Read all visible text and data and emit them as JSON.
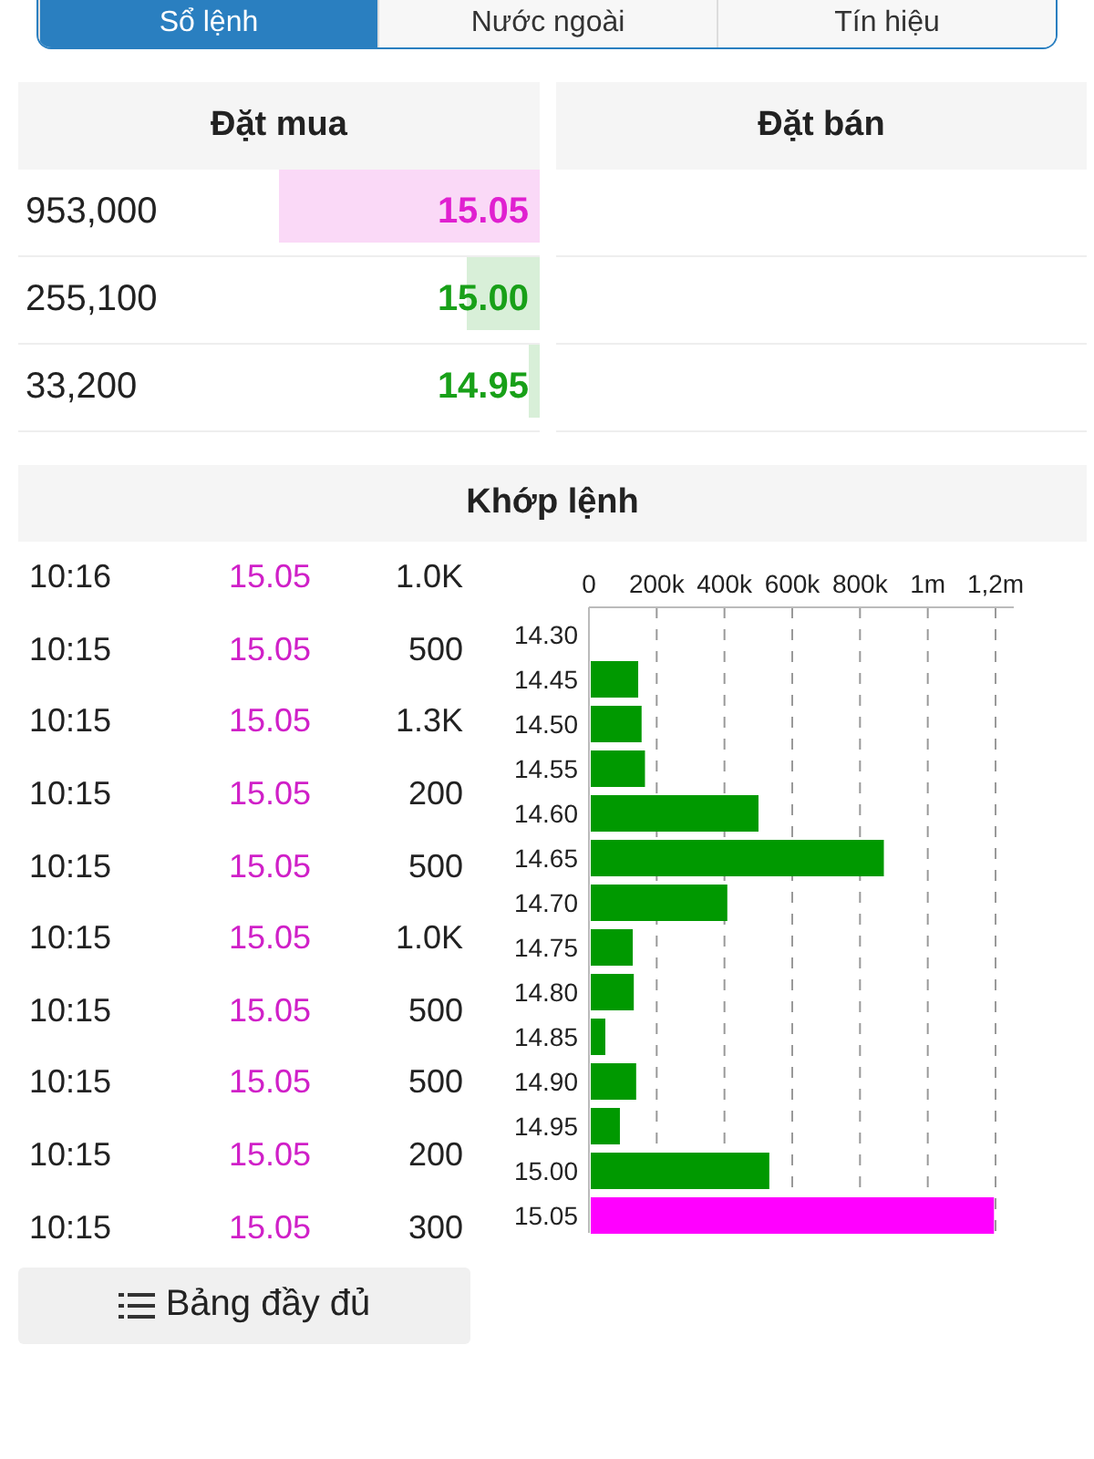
{
  "tabs": [
    {
      "label": "Sổ lệnh",
      "selected": true
    },
    {
      "label": "Nước ngoài",
      "selected": false
    },
    {
      "label": "Tín hiệu",
      "selected": false
    }
  ],
  "order_book": {
    "buy_header": "Đặt mua",
    "sell_header": "Đặt bán",
    "bids": [
      {
        "volume": "953,000",
        "price": "15.05",
        "color": "#e020d0",
        "level": 0.5
      },
      {
        "volume": "255,100",
        "price": "15.00",
        "color": "#18a018",
        "level": 0.14
      },
      {
        "volume": "33,200",
        "price": "14.95",
        "color": "#18a018",
        "level": 0.02
      }
    ]
  },
  "matches": {
    "title": "Khớp lệnh",
    "rows": [
      {
        "time": "10:16",
        "price": "15.05",
        "volume": "1.0K"
      },
      {
        "time": "10:15",
        "price": "15.05",
        "volume": "500"
      },
      {
        "time": "10:15",
        "price": "15.05",
        "volume": "1.3K"
      },
      {
        "time": "10:15",
        "price": "15.05",
        "volume": "200"
      },
      {
        "time": "10:15",
        "price": "15.05",
        "volume": "500"
      },
      {
        "time": "10:15",
        "price": "15.05",
        "volume": "1.0K"
      },
      {
        "time": "10:15",
        "price": "15.05",
        "volume": "500"
      },
      {
        "time": "10:15",
        "price": "15.05",
        "volume": "500"
      },
      {
        "time": "10:15",
        "price": "15.05",
        "volume": "200"
      },
      {
        "time": "10:15",
        "price": "15.05",
        "volume": "300"
      }
    ],
    "chart_data": {
      "type": "bar",
      "orientation": "horizontal",
      "grid": true,
      "categories": [
        "14.30",
        "14.45",
        "14.50",
        "14.55",
        "14.60",
        "14.65",
        "14.70",
        "14.75",
        "14.80",
        "14.85",
        "14.90",
        "14.95",
        "15.00",
        "15.05"
      ],
      "series": [
        {
          "color": "#009900",
          "values": [
            0,
            140000,
            150000,
            160000,
            495000,
            865000,
            403000,
            124000,
            127000,
            43000,
            134000,
            86000,
            527000,
            null
          ]
        },
        {
          "color": "#ff00ff",
          "values": [
            null,
            null,
            null,
            null,
            null,
            null,
            null,
            null,
            null,
            null,
            null,
            null,
            null,
            1190000
          ]
        }
      ],
      "xlim": [
        0,
        1200000
      ],
      "xticks": [
        {
          "value": 0,
          "label": "0"
        },
        {
          "value": 200000,
          "label": "200k"
        },
        {
          "value": 400000,
          "label": "400k"
        },
        {
          "value": 600000,
          "label": "600k"
        },
        {
          "value": 800000,
          "label": "800k"
        },
        {
          "value": 1000000,
          "label": "1m"
        },
        {
          "value": 1200000,
          "label": "1,2m"
        }
      ]
    },
    "full_button": "Bảng đầy đủ"
  }
}
